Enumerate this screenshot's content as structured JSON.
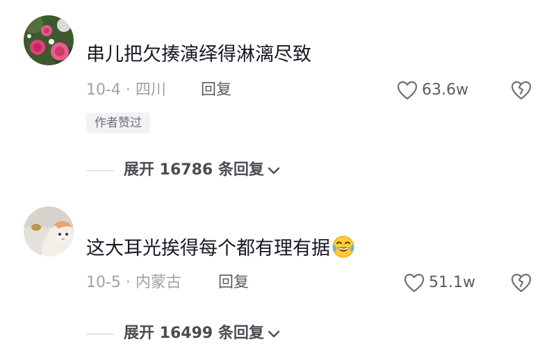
{
  "comments": [
    {
      "text": "串儿把欠揍演绎得淋漓尽致",
      "date_location": "10-4 · 四川",
      "reply_label": "回复",
      "likes": "63.6w",
      "author_badge": "作者赞过",
      "expand_label": "展开 16786 条回复",
      "avatar_icon": "pink-roses-avatar"
    },
    {
      "text": "这大耳光挨得每个都有理有据",
      "emoji_icon": "laughing-tears-emoji",
      "date_location": "10-5 · 内蒙古",
      "reply_label": "回复",
      "likes": "51.1w",
      "expand_label": "展开 16499 条回复",
      "avatar_icon": "cat-avatar"
    }
  ],
  "colors": {
    "primary_text": "#161823",
    "secondary_text": "#a0a1a7",
    "action_text": "#5b5c63",
    "badge_bg": "#f2f2f4"
  }
}
